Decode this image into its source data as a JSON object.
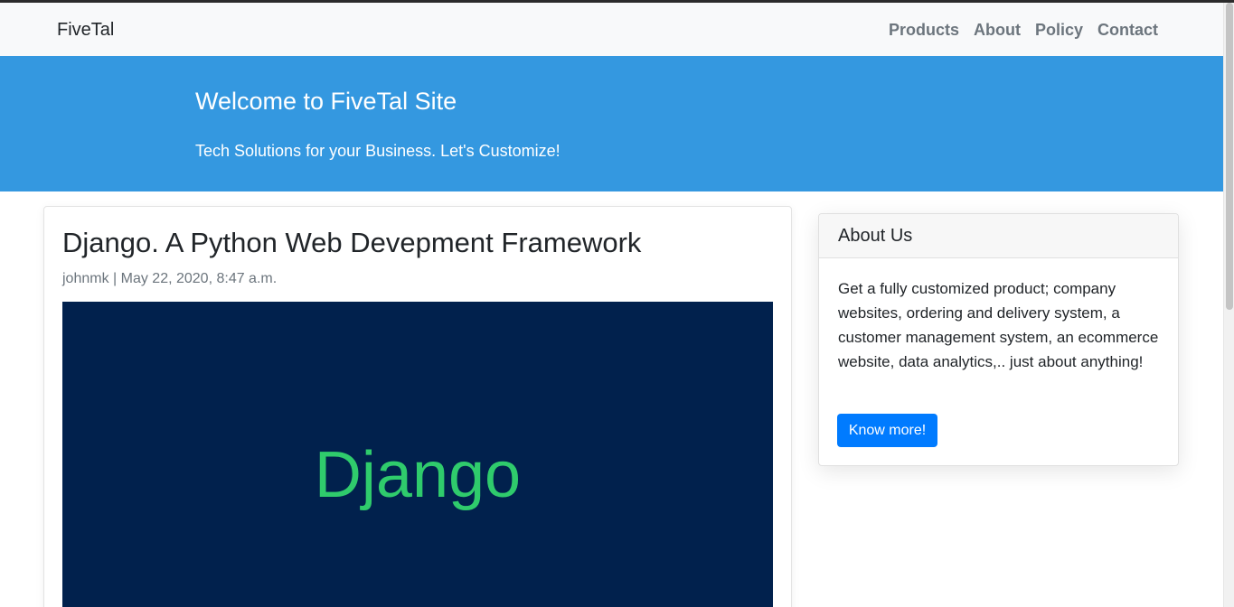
{
  "navbar": {
    "brand": "FiveTal",
    "links": [
      "Products",
      "About",
      "Policy",
      "Contact"
    ]
  },
  "hero": {
    "title": "Welcome to FiveTal Site",
    "subtitle": "Tech Solutions for your Business. Let's Customize!",
    "background_color": "#3498e0"
  },
  "post": {
    "title": "Django. A Python Web Devepment Framework",
    "meta": "johnmk | May 22, 2020, 8:47 a.m.",
    "image_text": "Django",
    "image_background": "#01214d",
    "image_text_color": "#2fcb6c"
  },
  "about": {
    "title": "About Us",
    "body": "Get a fully customized product; company websites, ordering and delivery system, a customer management system, an ecommerce website, data analytics,.. just about anything!",
    "button_label": "Know more!",
    "button_color": "#007bff"
  }
}
